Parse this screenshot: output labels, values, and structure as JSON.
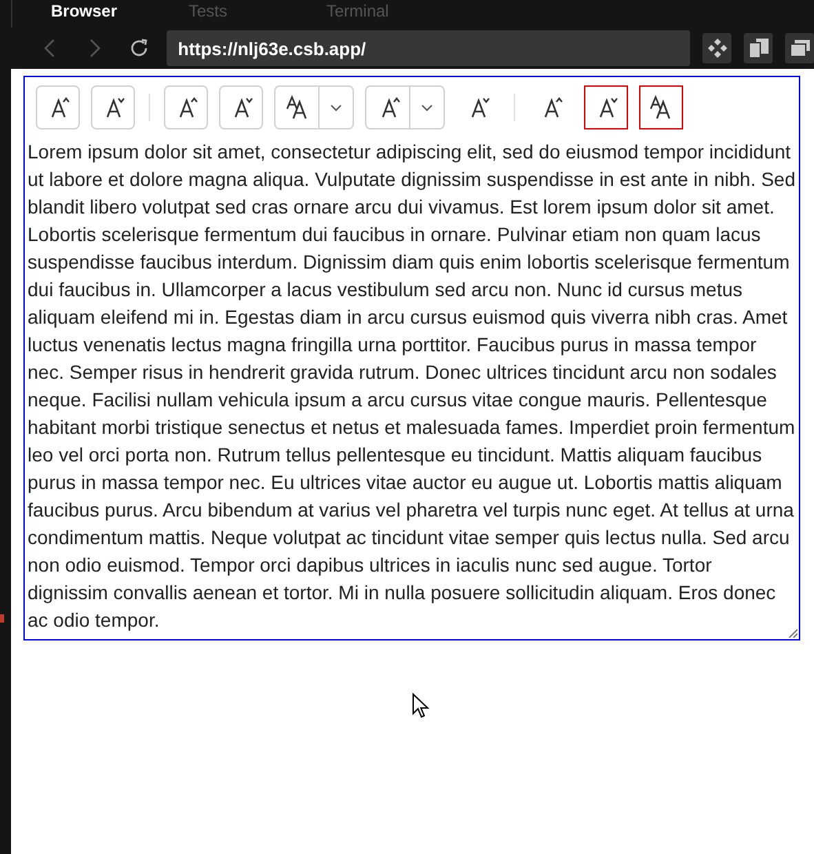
{
  "panel_tabs": [
    {
      "label": "Browser",
      "selected": true
    },
    {
      "label": "Tests",
      "selected": false
    },
    {
      "label": "Terminal",
      "selected": false
    }
  ],
  "address_bar": {
    "back_disabled": true,
    "forward_disabled": true,
    "url": "https://nlj63e.csb.app/"
  },
  "toolbar": [
    {
      "kind": "grow",
      "highlighted": false
    },
    {
      "kind": "shrink",
      "highlighted": false
    },
    {
      "kind": "separator"
    },
    {
      "kind": "grow",
      "highlighted": false
    },
    {
      "kind": "shrink",
      "highlighted": false
    },
    {
      "kind": "size-menu",
      "highlighted": false
    },
    {
      "kind": "grow-menu",
      "highlighted": false
    },
    {
      "kind": "shrink-plain",
      "highlighted": false
    },
    {
      "kind": "separator"
    },
    {
      "kind": "grow-plain",
      "highlighted": false
    },
    {
      "kind": "shrink",
      "highlighted": true
    },
    {
      "kind": "size",
      "highlighted": true
    }
  ],
  "text_area": {
    "value": "Lorem ipsum dolor sit amet, consectetur adipiscing elit, sed do eiusmod tempor incididunt ut labore et dolore magna aliqua. Vulputate dignissim suspendisse in est ante in nibh. Sed blandit libero volutpat sed cras ornare arcu dui vivamus. Est lorem ipsum dolor sit amet. Lobortis scelerisque fermentum dui faucibus in ornare. Pulvinar etiam non quam lacus suspendisse faucibus interdum. Dignissim diam quis enim lobortis scelerisque fermentum dui faucibus in. Ullamcorper a lacus vestibulum sed arcu non. Nunc id cursus metus aliquam eleifend mi in. Egestas diam in arcu cursus euismod quis viverra nibh cras. Amet luctus venenatis lectus magna fringilla urna porttitor. Faucibus purus in massa tempor nec. Semper risus in hendrerit gravida rutrum. Donec ultrices tincidunt arcu non sodales neque. Facilisi nullam vehicula ipsum a arcu cursus vitae congue mauris. Pellentesque habitant morbi tristique senectus et netus et malesuada fames. Imperdiet proin fermentum leo vel orci porta non. Rutrum tellus pellentesque eu tincidunt. Mattis aliquam faucibus purus in massa tempor nec. Eu ultrices vitae auctor eu augue ut. Lobortis mattis aliquam faucibus purus. Arcu bibendum at varius vel pharetra vel turpis nunc eget. At tellus at urna condimentum mattis. Neque volutpat ac tincidunt vitae semper quis lectus nulla. Sed arcu non odio euismod. Tempor orci dapibus ultrices in iaculis nunc sed augue. Tortor dignissim convallis aenean et tortor. Mi in nulla posuere sollicitudin aliquam. Eros donec ac odio tempor."
  }
}
